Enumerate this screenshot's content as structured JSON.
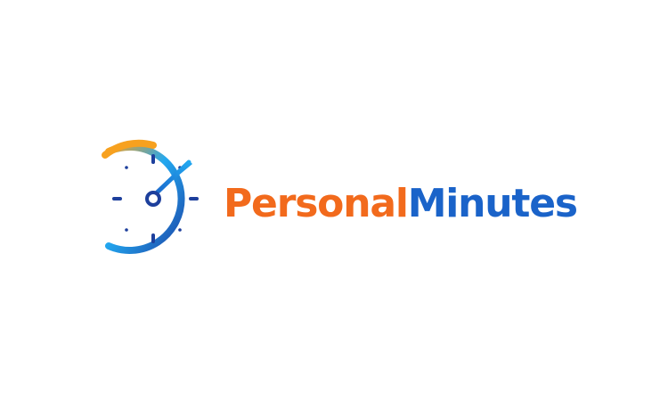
{
  "logo": {
    "word_one": "Personal",
    "word_two": "Minutes",
    "icon": "stopwatch-gauge-icon",
    "colors": {
      "orange": "#f26a1c",
      "amber": "#f7a11f",
      "blue": "#1a63c9",
      "dark_blue": "#1d47a8",
      "light_blue": "#22a8f0"
    }
  }
}
